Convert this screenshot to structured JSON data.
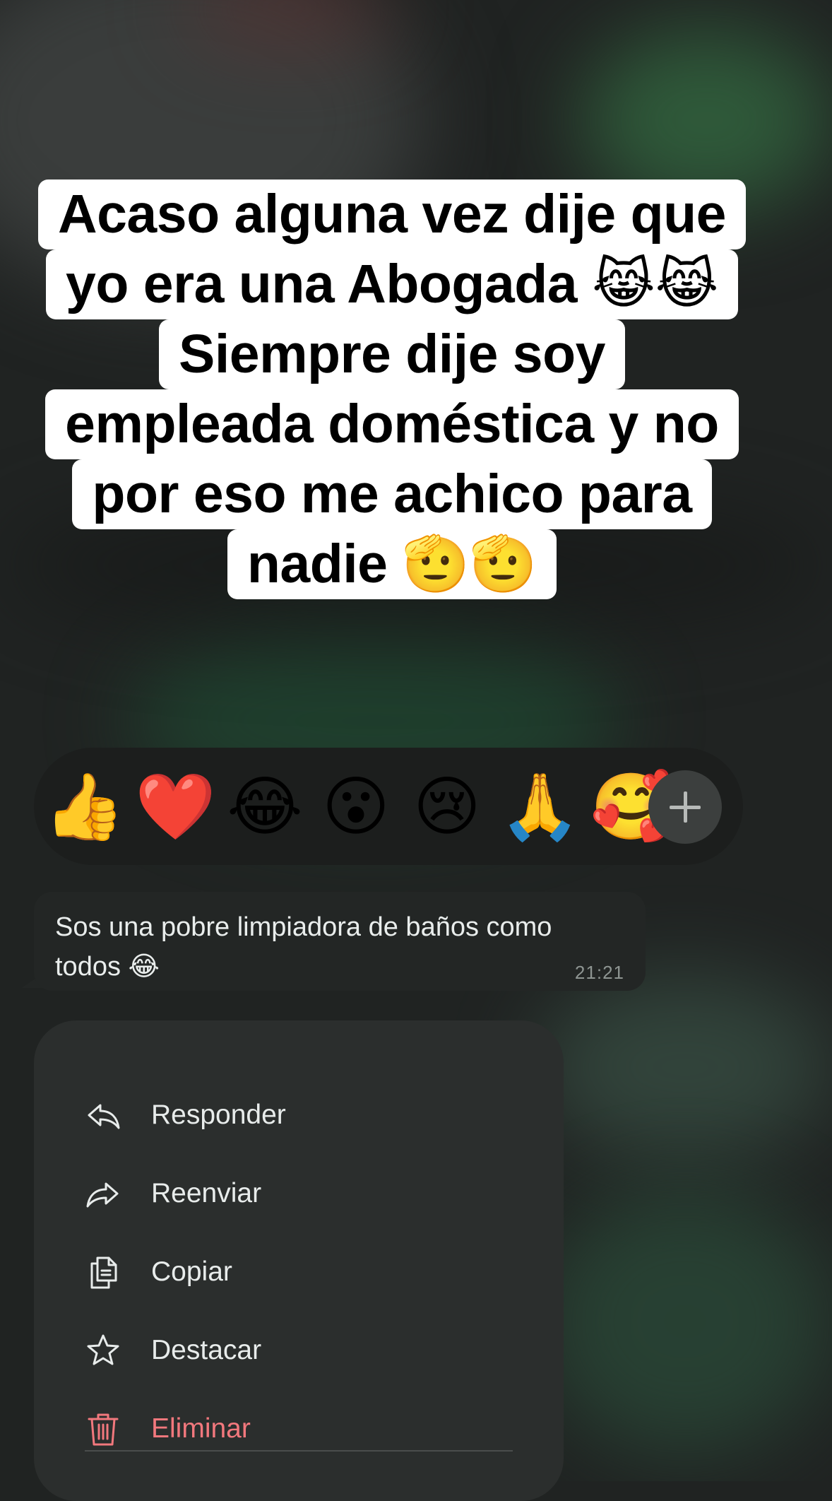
{
  "caption": {
    "lines": [
      "Acaso alguna vez dije que",
      "yo era una Abogada 😹😹",
      "Siempre dije soy",
      "empleada doméstica y no",
      "por eso me achico para",
      "nadie 🫡🫡"
    ]
  },
  "reactions": {
    "emojis": [
      "👍",
      "❤️",
      "😂",
      "😮",
      "😢",
      "🙏",
      "🥰"
    ],
    "more_icon": "plus-icon"
  },
  "message": {
    "text": "Sos una pobre limpiadora de baños como todos 😂",
    "time": "21:21"
  },
  "menu": {
    "items": [
      {
        "label": "Responder",
        "icon": "reply-icon"
      },
      {
        "label": "Reenviar",
        "icon": "forward-icon"
      },
      {
        "label": "Copiar",
        "icon": "copy-icon"
      },
      {
        "label": "Destacar",
        "icon": "star-icon"
      },
      {
        "label": "Eliminar",
        "icon": "trash-icon"
      }
    ],
    "danger_color": "#f2787d"
  }
}
